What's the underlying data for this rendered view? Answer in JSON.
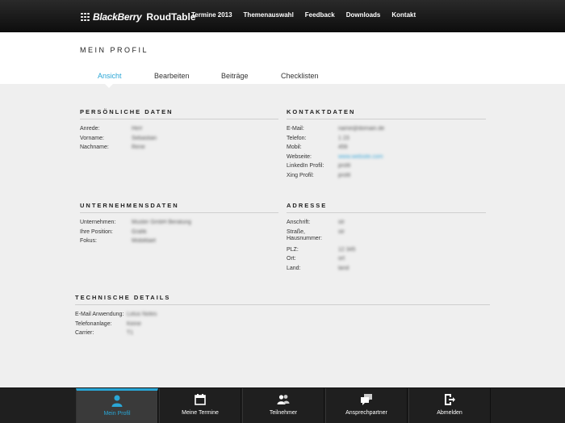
{
  "brand": {
    "name": "BlackBerry",
    "sub": "RoudTable"
  },
  "nav": [
    "Termine 2013",
    "Themenauswahl",
    "Feedback",
    "Downloads",
    "Kontakt"
  ],
  "page_title": "MEIN PROFIL",
  "tabs": [
    "Ansicht",
    "Bearbeiten",
    "Beiträge",
    "Checklisten"
  ],
  "active_tab": "Ansicht",
  "sections": {
    "personal": {
      "title": "PERSÖNLICHE DATEN",
      "rows": [
        {
          "label": "Anrede:",
          "value": "Herr"
        },
        {
          "label": "Vorname:",
          "value": "Sebastian"
        },
        {
          "label": "Nachname:",
          "value": "Rene"
        }
      ]
    },
    "contact": {
      "title": "KONTAKTDATEN",
      "rows": [
        {
          "label": "E-Mail:",
          "value": "name@domain.de"
        },
        {
          "label": "Telefon:",
          "value": "1 23"
        },
        {
          "label": "Mobil:",
          "value": "456"
        },
        {
          "label": "Webseite:",
          "value": "www.website.com"
        },
        {
          "label": "LinkedIn Profil:",
          "value": "profil"
        },
        {
          "label": "Xing Profil:",
          "value": "profil"
        }
      ]
    },
    "company": {
      "title": "UNTERNEHMENSDATEN",
      "rows": [
        {
          "label": "Unternehmen:",
          "value": "Muster GmbH Beratung"
        },
        {
          "label": "Ihre Position:",
          "value": "Grafik"
        },
        {
          "label": "Fokus:",
          "value": "Mobilitaet"
        }
      ]
    },
    "address": {
      "title": "ADRESSE",
      "rows": [
        {
          "label": "Anschrift:",
          "value": "str"
        },
        {
          "label": "Straße, Hausnummer:",
          "value": "str"
        },
        {
          "label": "PLZ:",
          "value": "12 345"
        },
        {
          "label": "Ort:",
          "value": "ort"
        },
        {
          "label": "Land:",
          "value": "land"
        }
      ]
    },
    "technical": {
      "title": "TECHNISCHE DETAILS",
      "rows": [
        {
          "label": "E-Mail Anwendung:",
          "value": "Lotus Notes"
        },
        {
          "label": "Telefonanlage:",
          "value": "Keine"
        },
        {
          "label": "Carrier:",
          "value": "T1"
        }
      ]
    }
  },
  "bottom_nav": [
    {
      "label": "Mein Profil",
      "icon": "user-icon",
      "active": true
    },
    {
      "label": "Meine Termine",
      "icon": "calendar-icon",
      "active": false
    },
    {
      "label": "Teilnehmer",
      "icon": "people-icon",
      "active": false
    },
    {
      "label": "Ansprechpartner",
      "icon": "chat-icon",
      "active": false
    },
    {
      "label": "Abmelden",
      "icon": "logout-icon",
      "active": false
    }
  ],
  "colors": {
    "accent": "#2aa6d6",
    "topbar": "#111111",
    "bottombar": "#1f1f1f",
    "background": "#efefef"
  }
}
